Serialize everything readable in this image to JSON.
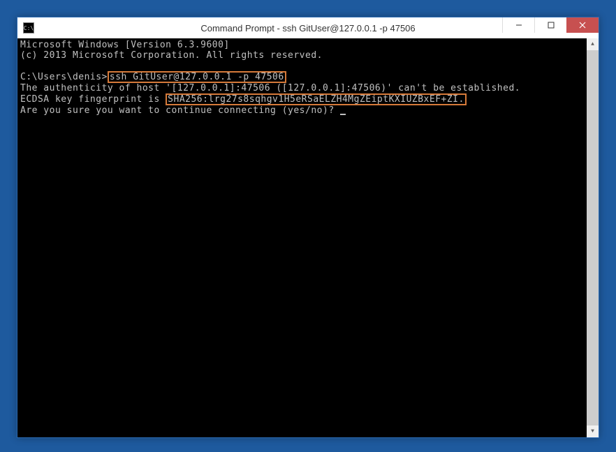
{
  "window": {
    "title": "Command Prompt - ssh  GitUser@127.0.0.1 -p 47506",
    "icon_label": "C:\\"
  },
  "terminal": {
    "line1": "Microsoft Windows [Version 6.3.9600]",
    "line2": "(c) 2013 Microsoft Corporation. All rights reserved.",
    "prompt_prefix": "C:\\Users\\denis>",
    "ssh_command": "ssh GitUser@127.0.0.1 -p 47506",
    "auth_line": "The authenticity of host '[127.0.0.1]:47506 ([127.0.0.1]:47506)' can't be established.",
    "fingerprint_prefix": "ECDSA key fingerprint is ",
    "fingerprint_value": "SHA256:lrg27s8sqhgv1H5eRSaELZH4MgZEiptKXIUZBxEF+ZI.",
    "confirm_prompt": "Are you sure you want to continue connecting (yes/no)? "
  }
}
